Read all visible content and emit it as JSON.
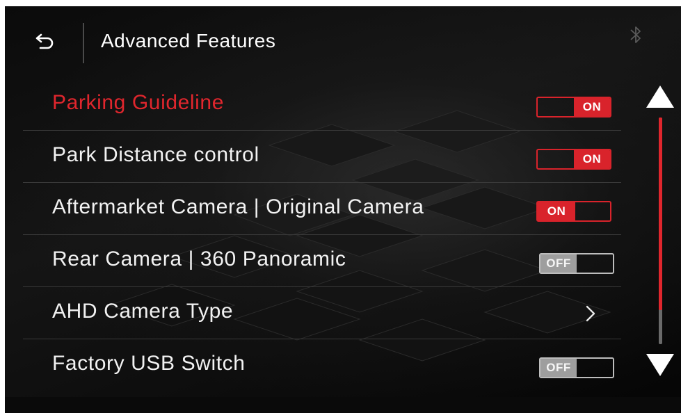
{
  "header": {
    "title": "Advanced Features",
    "back_icon": "back-arrow-icon",
    "status_icon": "bluetooth-icon"
  },
  "colors": {
    "accent_red": "#d9232b",
    "off_grey": "#9e9e9e",
    "text": "#f2f2f2",
    "background": "#0d0d0d"
  },
  "settings": [
    {
      "label": "Parking  Guideline",
      "control": "toggle",
      "state": "ON",
      "variant": "on-right",
      "active": true
    },
    {
      "label": "Park  Distance  control",
      "control": "toggle",
      "state": "ON",
      "variant": "on-right",
      "active": false
    },
    {
      "label": "Aftermarket  Camera  |  Original  Camera",
      "control": "toggle",
      "state": "ON",
      "variant": "on-left",
      "active": false
    },
    {
      "label": "Rear  Camera  |  360  Panoramic",
      "control": "toggle",
      "state": "OFF",
      "variant": "off",
      "active": false
    },
    {
      "label": "AHD  Camera  Type",
      "control": "chevron",
      "icon": "chevron-right-icon",
      "active": false
    },
    {
      "label": "Factory  USB  Switch",
      "control": "toggle",
      "state": "OFF",
      "variant": "off",
      "active": false
    }
  ],
  "scroll": {
    "up_icon": "triangle-up-icon",
    "down_icon": "triangle-down-icon",
    "position_fraction": 0.0,
    "visible_fraction": 0.85
  }
}
